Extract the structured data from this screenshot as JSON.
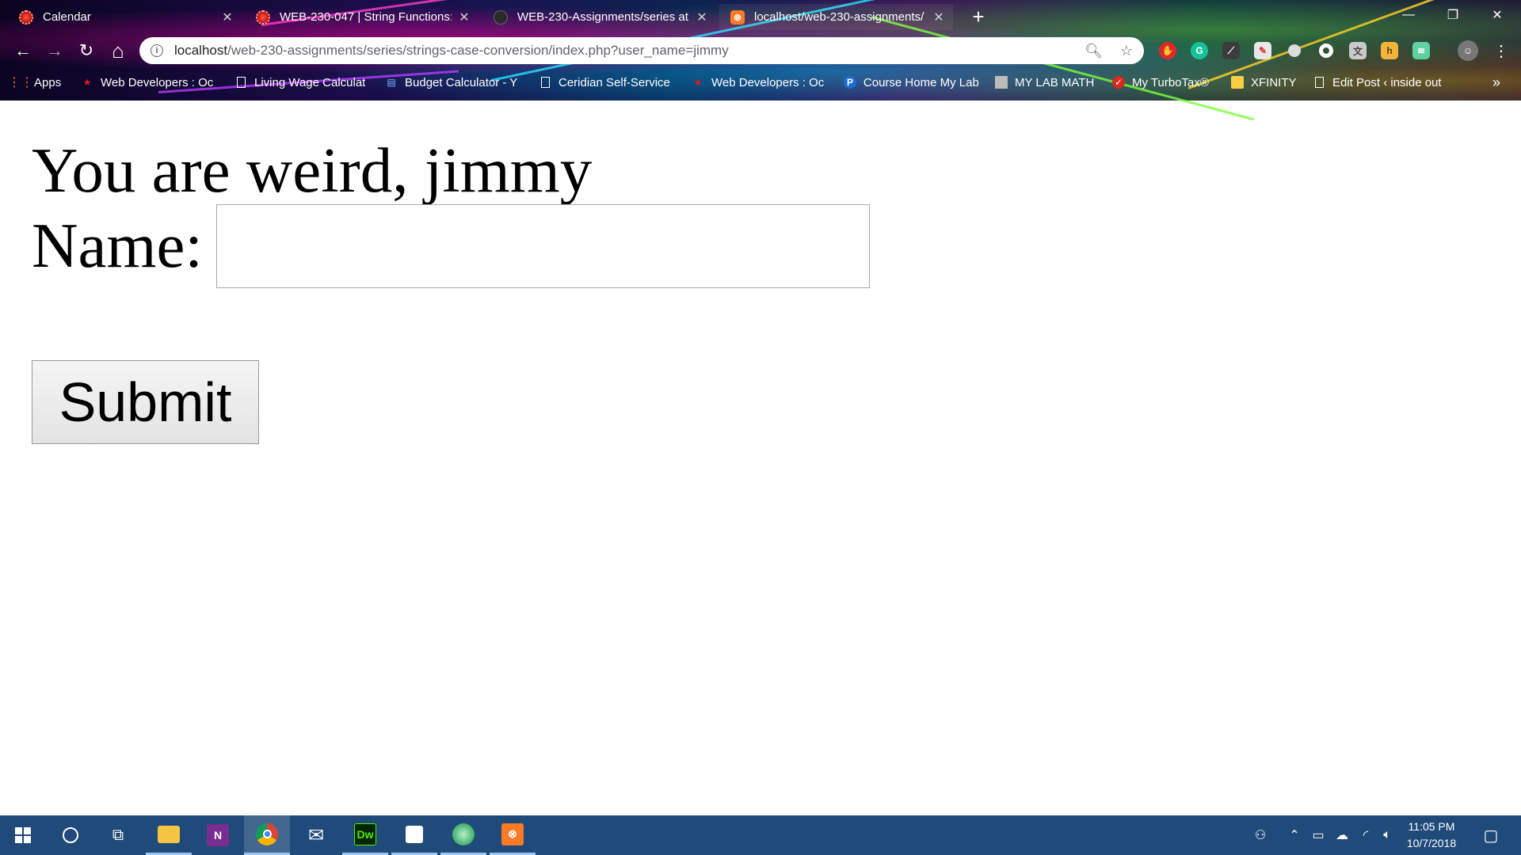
{
  "browser": {
    "tabs": [
      {
        "title": "Calendar",
        "favicon": "calendar-icon"
      },
      {
        "title": "WEB-230-047 | String Functions:",
        "favicon": "calendar-icon"
      },
      {
        "title": "WEB-230-Assignments/series at",
        "favicon": "github-icon"
      },
      {
        "title": "localhost/web-230-assignments/",
        "favicon": "xampp-icon"
      }
    ],
    "active_tab_index": 3,
    "new_tab_symbol": "+",
    "window_controls": {
      "minimize": "—",
      "restore": "❐",
      "close": "✕"
    },
    "nav": {
      "back": "←",
      "forward": "→",
      "reload": "↻",
      "home": "⌂"
    },
    "address": {
      "host": "localhost",
      "path": "/web-230-assignments/series/strings-case-conversion/index.php?user_name=jimmy"
    },
    "bookmarks": [
      {
        "label": "Apps",
        "icon": "apps-grid-icon"
      },
      {
        "label": "Web Developers : Oc",
        "icon": "red-star-icon"
      },
      {
        "label": "Living Wage Calculat",
        "icon": "page-icon"
      },
      {
        "label": "Budget Calculator - Y",
        "icon": "budget-icon"
      },
      {
        "label": "Ceridian Self-Service",
        "icon": "page-icon"
      },
      {
        "label": "Web Developers : Oc",
        "icon": "red-star-icon"
      },
      {
        "label": "Course Home My Lab",
        "icon": "pearson-icon"
      },
      {
        "label": "MY LAB MATH",
        "icon": "book-icon"
      },
      {
        "label": "My TurboTax®",
        "icon": "turbotax-icon"
      },
      {
        "label": "XFINITY",
        "icon": "folder-icon"
      },
      {
        "label": "Edit Post ‹ inside out",
        "icon": "page-icon"
      }
    ],
    "bookmarks_overflow": "»"
  },
  "page": {
    "heading": "You are weird, jimmy",
    "name_label": "Name:",
    "name_input_value": "",
    "submit_label": "Submit"
  },
  "taskbar": {
    "apps": [
      "windows-start-icon",
      "cortana-search-icon",
      "task-view-icon",
      "file-explorer-icon",
      "onenote-icon",
      "chrome-icon",
      "mail-icon",
      "dreamweaver-icon",
      "sticky-notes-icon",
      "globe-app-icon",
      "xampp-icon"
    ],
    "dreamweaver_text": "Dw",
    "onenote_text": "N",
    "clock_time": "11:05 PM",
    "clock_date": "10/7/2018"
  }
}
